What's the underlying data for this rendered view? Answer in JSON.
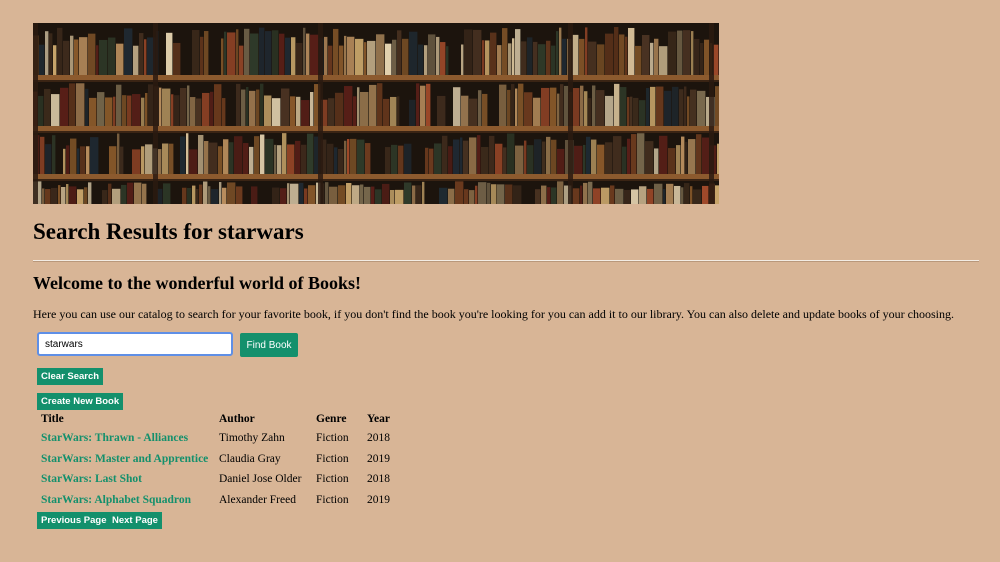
{
  "header": {
    "banner_alt": "bookshelf-banner",
    "page_title": "Search Results for starwars"
  },
  "welcome": {
    "heading": "Welcome to the wonderful world of Books!",
    "intro": "Here you can use our catalog to search for your favorite book, if you don't find the book you're looking for you can add it to our library. You can also delete and update books of your choosing."
  },
  "search": {
    "value": "starwars",
    "find_label": "Find Book",
    "clear_label": "Clear Search"
  },
  "actions": {
    "create_label": "Create New Book"
  },
  "table": {
    "headers": [
      "Title",
      "Author",
      "Genre",
      "Year"
    ],
    "rows": [
      {
        "title": "StarWars: Thrawn - Alliances",
        "author": "Timothy Zahn",
        "genre": "Fiction",
        "year": "2018"
      },
      {
        "title": "StarWars: Master and Apprentice",
        "author": "Claudia Gray",
        "genre": "Fiction",
        "year": "2019"
      },
      {
        "title": "StarWars: Last Shot",
        "author": "Daniel Jose Older",
        "genre": "Fiction",
        "year": "2018"
      },
      {
        "title": "StarWars: Alphabet Squadron",
        "author": "Alexander Freed",
        "genre": "Fiction",
        "year": "2019"
      }
    ]
  },
  "pagination": {
    "prev_label": "Previous Page",
    "next_label": "Next Page"
  },
  "colors": {
    "background": "#d8b596",
    "accent": "#13906c",
    "input_border": "#5f8fe6"
  }
}
